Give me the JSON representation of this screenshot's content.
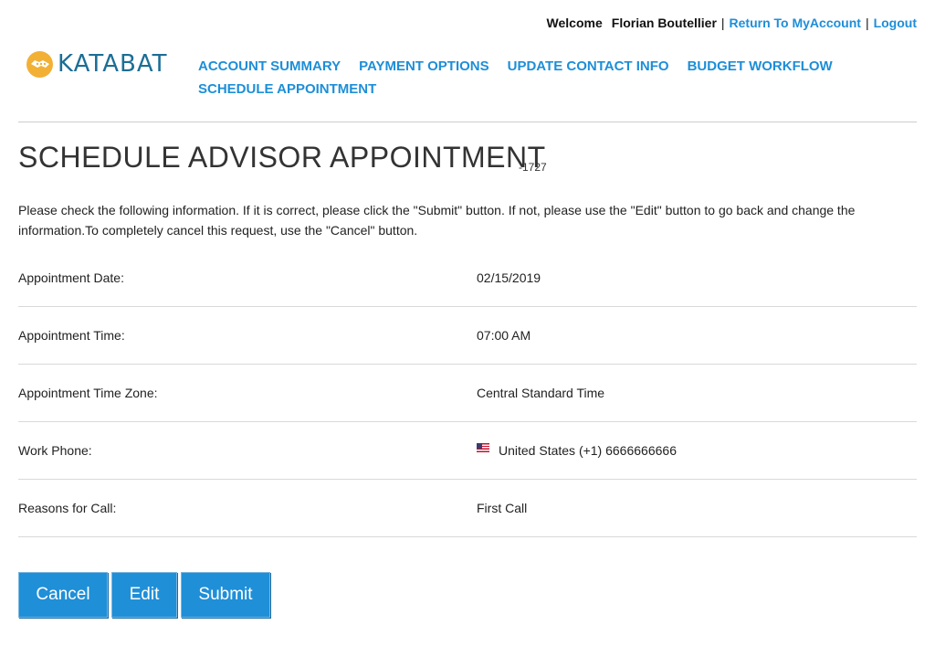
{
  "topbar": {
    "welcome": "Welcome",
    "user_name": "Florian Boutellier",
    "separator": "|",
    "return_link": "Return To MyAccount",
    "logout_link": "Logout"
  },
  "logo": {
    "text": "KATABAT",
    "icon": "handshake-icon"
  },
  "nav": {
    "items": [
      "ACCOUNT SUMMARY",
      "PAYMENT OPTIONS",
      "UPDATE CONTACT INFO",
      "BUDGET WORKFLOW",
      "SCHEDULE APPOINTMENT"
    ]
  },
  "page": {
    "title": "SCHEDULE ADVISOR APPOINTMENT",
    "account_suffix": "-1727",
    "intro": "Please check the following information. If it is correct, please click the \"Submit\" button. If not, please use the \"Edit\" button to go back and change the information.To completely cancel this request, use the \"Cancel\" button."
  },
  "details": {
    "rows": [
      {
        "label": "Appointment Date:",
        "value": "02/15/2019"
      },
      {
        "label": "Appointment Time:",
        "value": "07:00 AM"
      },
      {
        "label": "Appointment Time Zone:",
        "value": "Central Standard Time"
      },
      {
        "label": "Work Phone:",
        "value": "United States (+1) 6666666666",
        "icon": "us-flag-icon"
      },
      {
        "label": "Reasons for Call:",
        "value": "First Call"
      }
    ]
  },
  "buttons": {
    "cancel": "Cancel",
    "edit": "Edit",
    "submit": "Submit"
  },
  "colors": {
    "link": "#1d8ed8",
    "button": "#1f8fd8",
    "logo_mark": "#f2b035",
    "logo_text": "#1c6e96"
  }
}
